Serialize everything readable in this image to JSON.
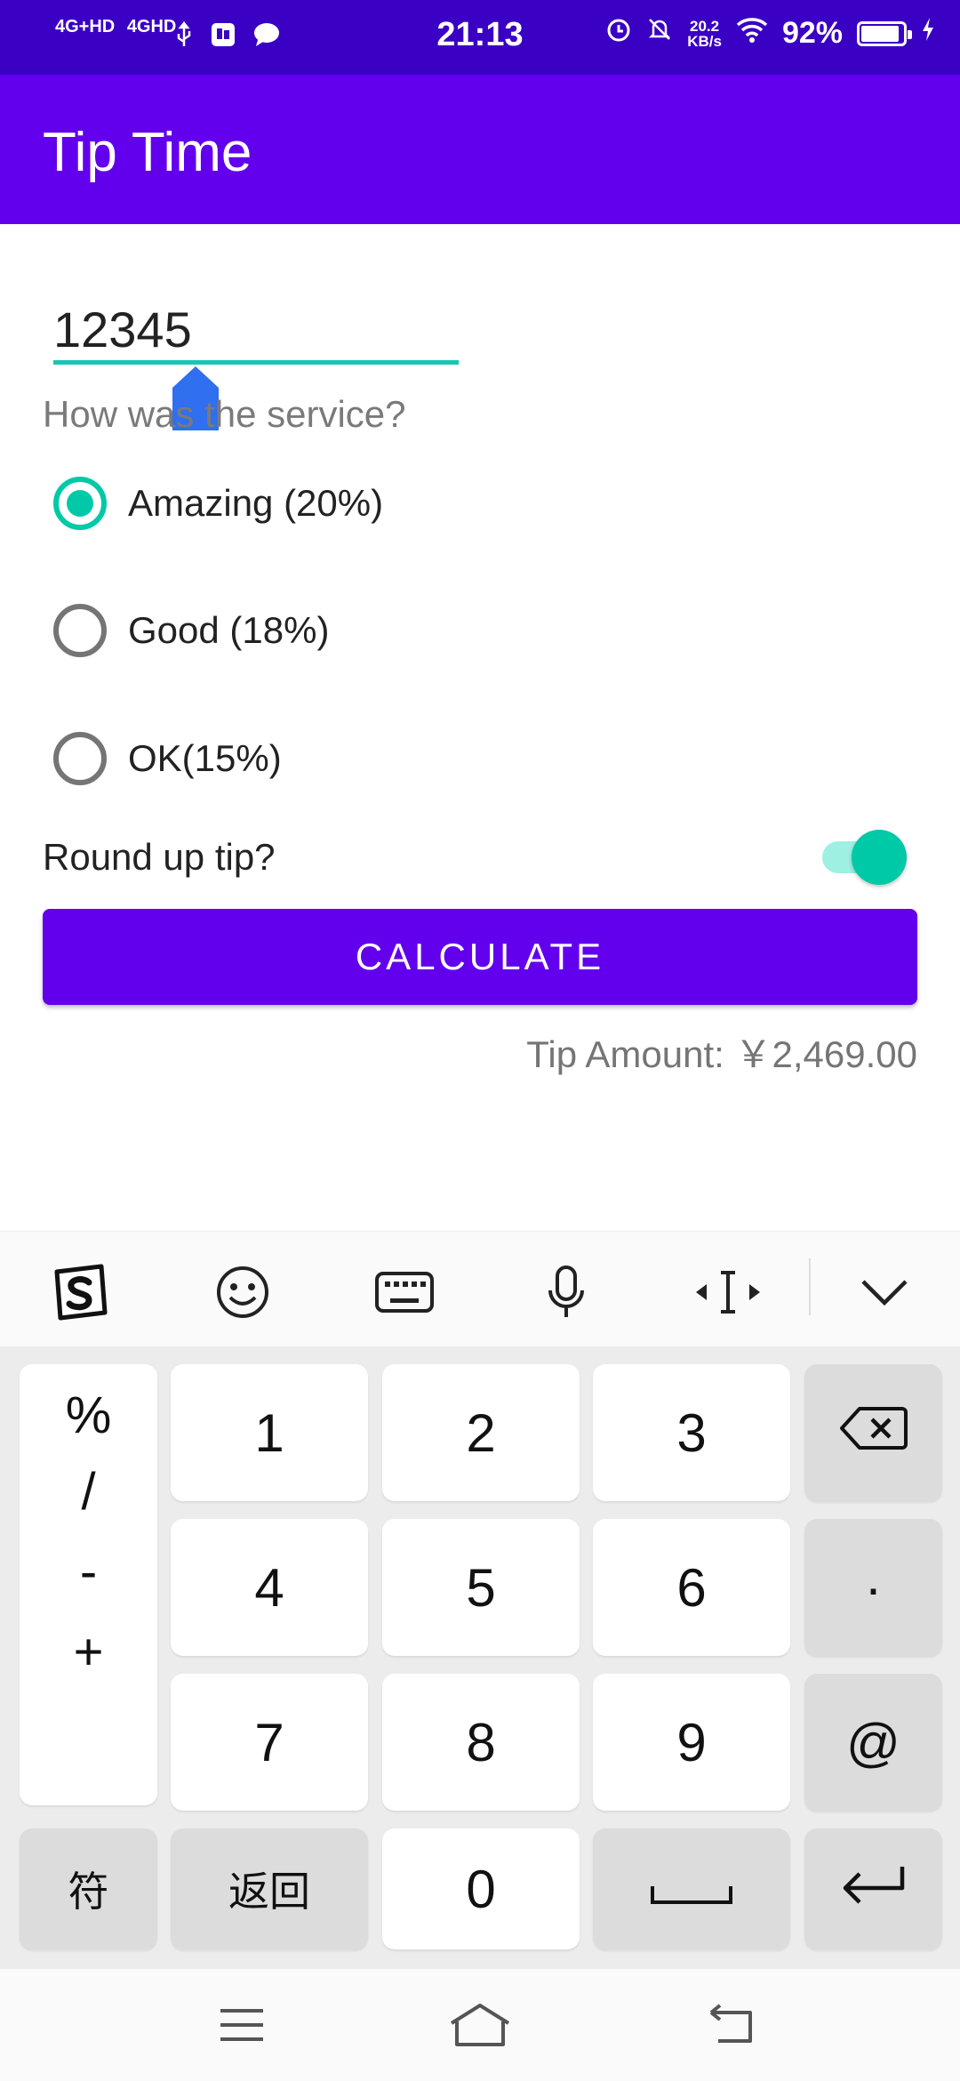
{
  "status_bar": {
    "network_1": "4G+HD",
    "network_2": "4GHD",
    "time": "21:13",
    "speed_value": "20.2",
    "speed_unit": "KB/s",
    "battery": "92%",
    "battery_level": 0.92
  },
  "app": {
    "title": "Tip Time"
  },
  "form": {
    "cost_value": "12345",
    "service_question": "How was the service?",
    "options": [
      {
        "label": "Amazing (20%)",
        "checked": true
      },
      {
        "label": "Good (18%)",
        "checked": false
      },
      {
        "label": "OK(15%)",
        "checked": false
      }
    ],
    "round_up_label": "Round up tip?",
    "round_up_on": true,
    "calculate_label": "CALCULATE",
    "tip_result": "Tip Amount: ￥2,469.00"
  },
  "keyboard": {
    "symbols": [
      "%",
      "/",
      "-",
      "+"
    ],
    "digits": [
      "1",
      "2",
      "3",
      "4",
      "5",
      "6",
      "7",
      "8",
      "9",
      "0"
    ],
    "dot_key": "·",
    "at_key": "@",
    "symbols_key": "符",
    "back_key": "返回",
    "toolbar_icons": [
      "sogou-logo-icon",
      "emoji-icon",
      "keyboard-icon",
      "microphone-icon",
      "cursor-move-icon",
      "collapse-chevron-icon"
    ]
  },
  "colors": {
    "status_bar": "#3a00c4",
    "app_bar": "#6200ee",
    "accent": "#00c9a7",
    "button": "#6200ee"
  }
}
